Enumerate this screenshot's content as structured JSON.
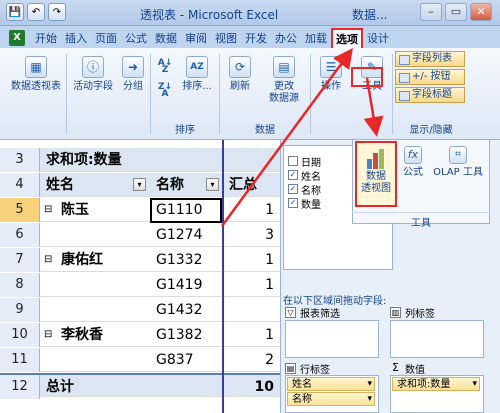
{
  "window": {
    "title": "透视表 - Microsoft Excel",
    "title_right": "数据...",
    "controls": [
      "–",
      "▭",
      "✕"
    ]
  },
  "qat": [
    "💾",
    "↶",
    "↷"
  ],
  "tabs": [
    {
      "label": "开始",
      "active": false
    },
    {
      "label": "插入",
      "active": false
    },
    {
      "label": "页面",
      "active": false
    },
    {
      "label": "公式",
      "active": false
    },
    {
      "label": "数据",
      "active": false
    },
    {
      "label": "审阅",
      "active": false
    },
    {
      "label": "视图",
      "active": false
    },
    {
      "label": "开发",
      "active": false
    },
    {
      "label": "办公",
      "active": false
    },
    {
      "label": "加载",
      "active": false
    },
    {
      "label": "选项",
      "active": true
    },
    {
      "label": "设计",
      "active": false
    }
  ],
  "ribbon": {
    "pivot_table": "数据透视表",
    "active_field": "活动字段",
    "group": "分组",
    "sort": "排序...",
    "sort_group": "排序",
    "refresh": "刷新",
    "change_source_line1": "更改",
    "change_source_line2": "数据源",
    "data_group": "数据",
    "actions": "操作",
    "tools": "工具",
    "field_list": "字段列表",
    "buttons_toggle": "+/- 按钮",
    "field_headers": "字段标题",
    "show_hide_group": "显示/隐藏"
  },
  "popup": {
    "pivot_chart_line1": "数据",
    "pivot_chart_line2": "透视图",
    "formulas": "公式",
    "olap": "OLAP 工具",
    "tools_label": "工具"
  },
  "grid": {
    "rows": [
      {
        "num": "3",
        "a": "求和项:数量",
        "b": "",
        "c": ""
      },
      {
        "num": "4",
        "a": "姓名",
        "b": "名称",
        "c": "汇总"
      },
      {
        "num": "5",
        "a": "陈玉",
        "b": "G1110",
        "c": "1"
      },
      {
        "num": "6",
        "a": "",
        "b": "G1274",
        "c": "3"
      },
      {
        "num": "7",
        "a": "康佑红",
        "b": "G1332",
        "c": "1"
      },
      {
        "num": "8",
        "a": "",
        "b": "G1419",
        "c": "1"
      },
      {
        "num": "9",
        "a": "",
        "b": "G1432",
        "c": ""
      },
      {
        "num": "10",
        "a": "李秋香",
        "b": "G1382",
        "c": "1"
      },
      {
        "num": "11",
        "a": "",
        "b": "G837",
        "c": "2"
      },
      {
        "num": "12",
        "a": "总计",
        "b": "",
        "c": "10"
      }
    ]
  },
  "field_panel": {
    "fields": [
      {
        "label": "日期",
        "checked": false
      },
      {
        "label": "姓名",
        "checked": true
      },
      {
        "label": "名称",
        "checked": true
      },
      {
        "label": "数量",
        "checked": true
      }
    ],
    "drag_caption": "在以下区域间拖动字段:",
    "report_filter": "报表筛选",
    "column_labels": "列标签",
    "row_labels": "行标签",
    "values": "数值",
    "row_pills": [
      "姓名",
      "名称"
    ],
    "value_pill": "求和项:数量"
  },
  "colors": {
    "accent_red": "#e62828",
    "header_blue": "#15428b"
  }
}
